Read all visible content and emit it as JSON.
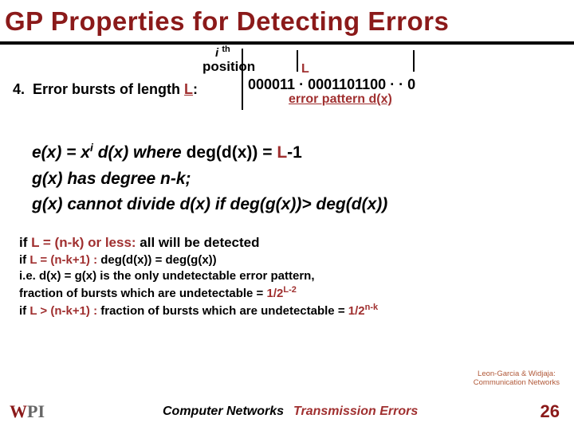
{
  "title": "GP Properties for Detecting Errors",
  "annot": {
    "i": "i",
    "th": "th",
    "position": "position",
    "L": "L",
    "bits": "000011 ·   0001101100 · · 0",
    "error_pattern": "error pattern d(x)"
  },
  "line4": {
    "num": "4.",
    "text1": "Error bursts of length ",
    "L": "L",
    "colon": ":"
  },
  "eq": {
    "l1a": "e(x) = x",
    "l1sup": "i",
    "l1b": "  d(x)      where ",
    "l1c": "deg(d(x)) = ",
    "l1d": "L",
    "l1e": "-1",
    "l2": "g(x) has degree n-k;",
    "l3": "g(x) cannot divide d(x)  if deg(g(x))> deg(d(x))"
  },
  "ifb": {
    "r1a": "if ",
    "r1b": "L = (n-k)  or less:",
    "r1c": "  all will be detected",
    "r2a": "if ",
    "r2b": "L = (n-k+1) :",
    "r2c": "   deg(d(x)) = deg(g(x))",
    "r3": "   i.e.  d(x) = g(x) is the only undetectable error pattern,",
    "r4a": "   fraction of bursts which are undetectable = ",
    "r4b": "1/2",
    "r4sup": "L-2",
    "r5a": "if ",
    "r5b": "L > (n-k+1) :",
    "r5c": "  fraction of bursts which are undetectable = ",
    "r5d": "1/2",
    "r5sup": "n-k"
  },
  "credit": {
    "l1": "Leon-Garcia & Widjaja:",
    "l2": "Communication Networks"
  },
  "footer": {
    "course": "Computer Networks",
    "topic": "Transmission Errors",
    "num": "26"
  }
}
